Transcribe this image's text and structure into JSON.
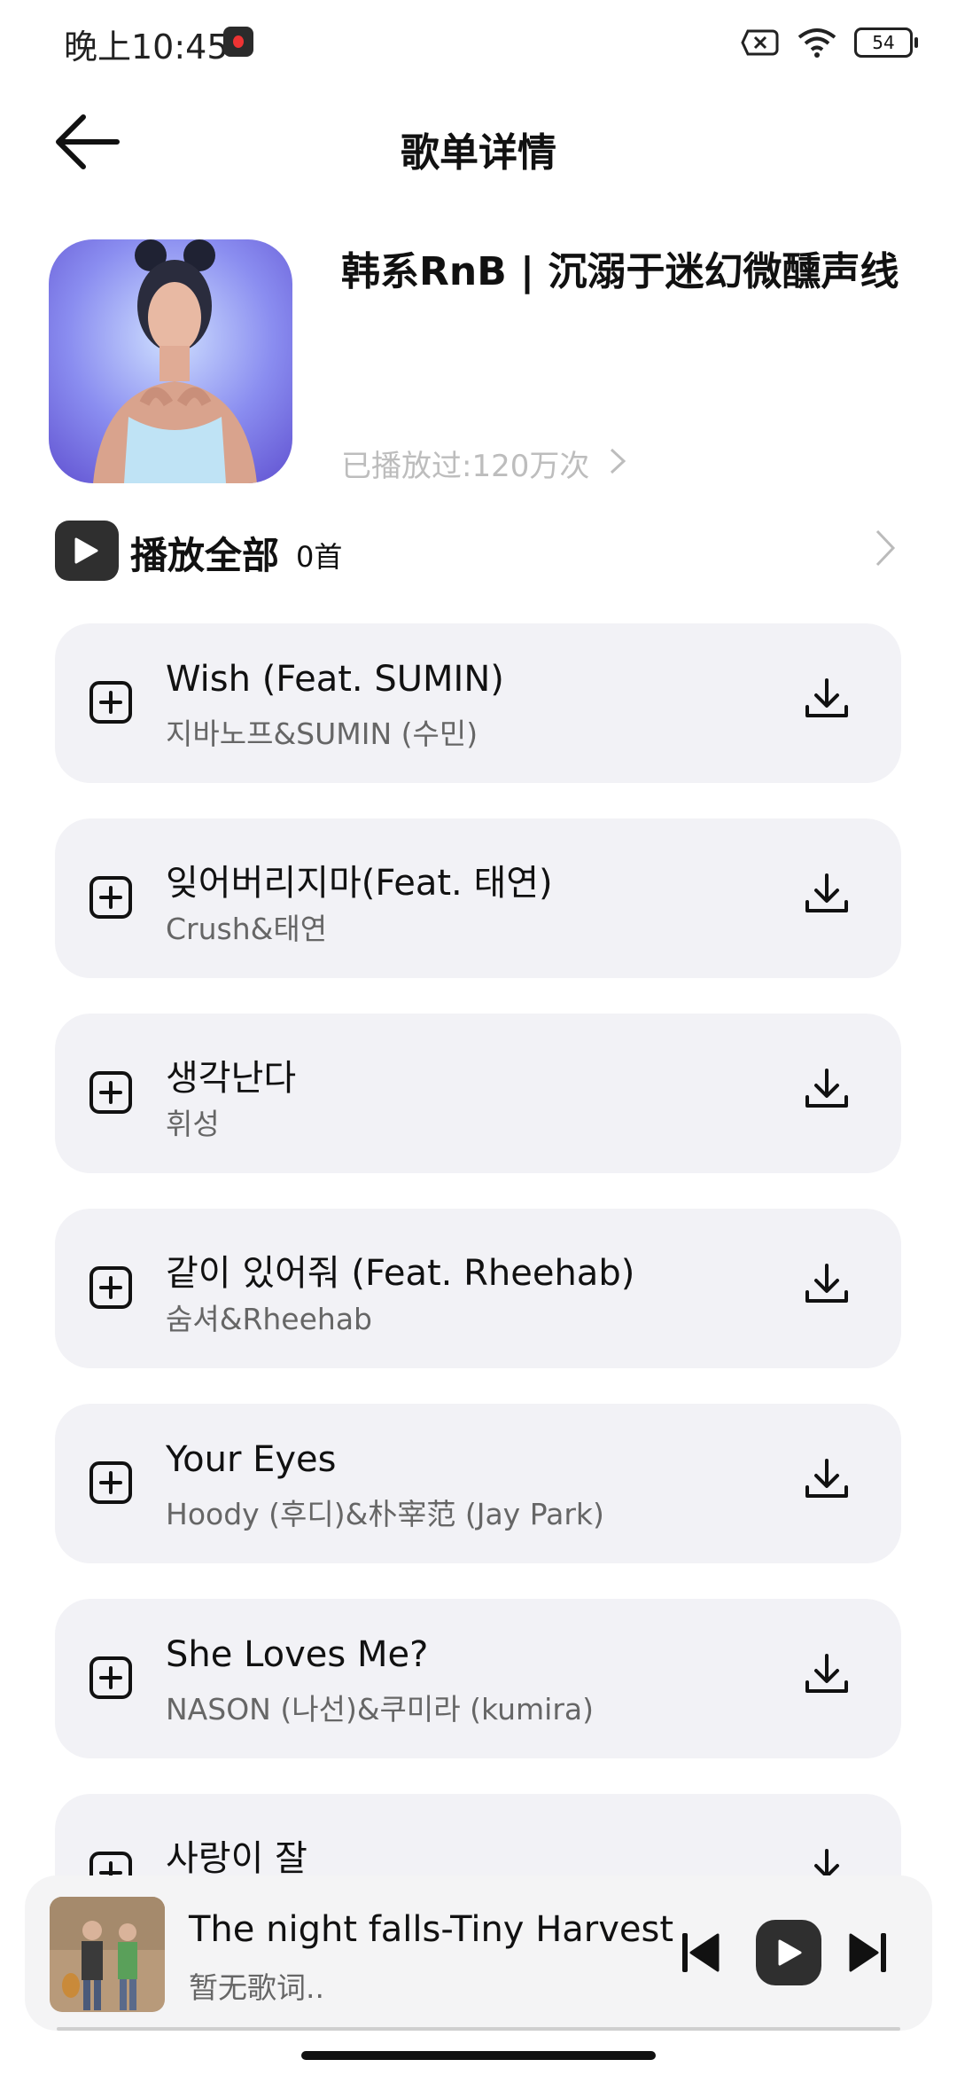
{
  "status_bar": {
    "time": "晚上10:45",
    "battery": "54"
  },
  "header": {
    "title": "歌单详情"
  },
  "playlist": {
    "name": "韩系RnB | 沉溺于迷幻微醺声线",
    "play_count": "已播放过:120万次"
  },
  "play_all": {
    "label": "播放全部",
    "count": "0首"
  },
  "songs": [
    {
      "title": "Wish (Feat. SUMIN)",
      "artist": "지바노프&SUMIN (수민)"
    },
    {
      "title": "잊어버리지마(Feat. 태연)",
      "artist": "Crush&태연"
    },
    {
      "title": "생각난다",
      "artist": "휘성"
    },
    {
      "title": "같이 있어줘 (Feat. Rheehab)",
      "artist": "숨셔&Rheehab"
    },
    {
      "title": "Your Eyes",
      "artist": "Hoody (후디)&朴宰范 (Jay Park)"
    },
    {
      "title": "She Loves Me?",
      "artist": "NASON (나선)&쿠미라 (kumira)"
    },
    {
      "title": "사랑이 잘",
      "artist": ""
    }
  ],
  "now_playing": {
    "title": "The night falls-Tiny Harvest",
    "lyric": "暂无歌词.."
  },
  "icons": {
    "back": "arrow-left-icon",
    "add": "add-to-playlist-icon",
    "download": "download-icon",
    "play": "play-icon",
    "prev": "skip-previous-icon",
    "next": "skip-next-icon"
  },
  "colors": {
    "card_bg": "#f2f2f6",
    "dark_button": "#2f2f2f",
    "muted_text": "#bdbdbd"
  }
}
